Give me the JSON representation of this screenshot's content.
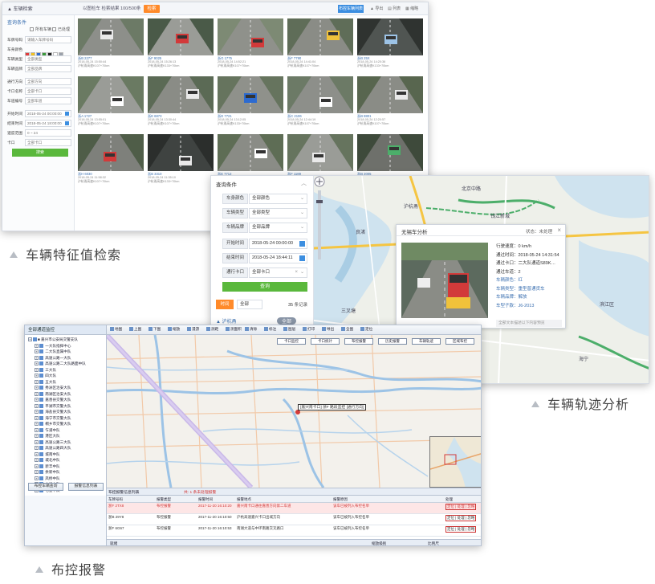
{
  "captions": {
    "search": "车辆特征值检索",
    "trajectory": "车辆轨迹分析",
    "alarm": "布控报警"
  },
  "search": {
    "app_title": "▲ 车辆检索",
    "crumb": "以图检车 检索结果 100/500条",
    "top_action": "检索",
    "top_btn": "布控车辆列表",
    "top_links": [
      "▲ 导出",
      "▤ 列表",
      "▦ 缩略"
    ],
    "side_title": "查询条件",
    "checks": [
      "所有车辆",
      "已处理"
    ],
    "filters": [
      {
        "label": "车牌号码",
        "value": "请输入车牌号码"
      },
      {
        "label": "车身颜色",
        "value": ""
      },
      {
        "label": "车辆类型",
        "value": "全部类型"
      },
      {
        "label": "车辆品牌",
        "value": "全部品牌"
      },
      {
        "label": "通行方向",
        "value": "全部方向"
      },
      {
        "label": "卡口名称",
        "value": "全部卡口"
      },
      {
        "label": "车道编号",
        "value": "全部车道"
      },
      {
        "label": "开始时间",
        "value": "2018-05-24 00:00:00"
      },
      {
        "label": "结束时间",
        "value": "2018-05-24 18:00:00"
      },
      {
        "label": "速度范围",
        "value": "0 ~ 24"
      },
      {
        "label": "卡口",
        "value": "全部卡口"
      }
    ],
    "swatch_colors": [
      "#e23b3b",
      "#f4c21f",
      "#2d6bd0",
      "#3a9a3a",
      "#222222",
      "#ffffff",
      "#9aa1aa"
    ],
    "search_btn": "搜索",
    "cards": [
      {
        "plate": "浙B 2277",
        "time": "2018-05-24 15:50:44",
        "place": "沪杭甬高速K107+70km"
      },
      {
        "plate": "浙F 9025",
        "time": "2018-05-24 15:26:13",
        "place": "沪杭甬高速K133+70km"
      },
      {
        "plate": "浙G 1775",
        "time": "2018-05-24 14:52:21",
        "place": "沪杭甬高速K107+70km"
      },
      {
        "plate": "浙F 7790",
        "time": "2018-05-24 14:41:04",
        "place": "沪杭甬高速K107+70km"
      },
      {
        "plate": "浙B 25X",
        "time": "2018-05-24 14:20:36",
        "place": "沪杭甬高速K133+70km"
      },
      {
        "plate": "浙A 1727",
        "time": "2018-05-24 13:55:01",
        "place": "沪杭甬高速K107+70km"
      },
      {
        "plate": "浙E 6873",
        "time": "2018-05-24 13:30:44",
        "place": "沪杭甬高速K107+70km"
      },
      {
        "plate": "浙D 7721",
        "time": "2018-05-24 13:12:05",
        "place": "沪杭甬高速K133+70km"
      },
      {
        "plate": "浙C 2106",
        "time": "2018-05-24 12:44:19",
        "place": "沪杭甬高速K107+70km"
      },
      {
        "plate": "浙B 8801",
        "time": "2018-05-24 12:20:57",
        "place": "沪杭甬高速K107+70km"
      },
      {
        "plate": "浙H 6030",
        "time": "2018-05-24 11:58:32",
        "place": "沪杭甬高速K107+70km"
      },
      {
        "plate": "浙B 3310",
        "time": "2018-05-24 11:35:10",
        "place": "沪杭甬高速K133+70km"
      },
      {
        "plate": "浙E 7712",
        "time": "2018-05-24 11:02:48",
        "place": "沪杭甬高速K107+70km"
      },
      {
        "plate": "浙F 1189",
        "time": "2018-05-24 10:41:27",
        "place": "沪杭甬高速K107+70km"
      },
      {
        "plate": "浙B 2005",
        "time": "2018-05-24 10:18:03",
        "place": "沪杭甬高速K133+70km"
      }
    ]
  },
  "trajectory": {
    "panel_title": "查询条件",
    "rows": [
      {
        "label": "车身颜色",
        "value": "全部颜色"
      },
      {
        "label": "车辆类型",
        "value": "全部类型"
      },
      {
        "label": "车辆品牌",
        "value": "全部品牌"
      },
      {
        "label": "开始时间",
        "value": "2018-05-24 00:00:00"
      },
      {
        "label": "结束时间",
        "value": "2018-05-24 18:44:11"
      },
      {
        "label": "通行卡口",
        "value": "全部卡口"
      }
    ],
    "query_btn": "查询",
    "tl_badge": "时间",
    "tl_select": "全部",
    "tl_count": "35",
    "tl_count_unit": "条记录",
    "bottom_tag": "▲ 沪杭甬",
    "bottom_btn": "全部",
    "map_labels": [
      "沪杭甬",
      "北京中路",
      "钱江新城",
      "三叉塘",
      "滨江区",
      "良渚",
      "海宁"
    ],
    "popup": {
      "title": "无锡车分析",
      "status": "状态：未处理",
      "speed": "行驶速度：0 km/h",
      "pass_time": "通过时间：2018-05-24 14:31:54",
      "checkpoint": "通过卡口：二大队通道S89K…",
      "lane": "通过车道：2",
      "color": "车辆颜色：红",
      "type": "车辆类型：重型普通货车",
      "brand": "车辆品牌：解放",
      "model": "车型子款：J6-2013",
      "footer": "全部文本描述以下内容预览"
    }
  },
  "alarm": {
    "tree_title": "全部通道监控",
    "tree_nodes": [
      "■ 嘉兴市公安局交警支队",
      "  一大队指挥中心",
      "  二大队直属中队",
      "  高速公路一大队",
      "  高速公路二大队路面中队",
      "  三大队",
      "  四大队",
      "  五大队",
      "  秀洲区治安大队",
      "  南湖区治安大队",
      "  嘉善县交警大队",
      "  平湖市交警大队",
      "  海盐县交警大队",
      "  海宁市交警大队",
      "  桐乡市交警大队",
      "  乍浦中队",
      "  港区大队",
      "  高速公路三大队",
      "  高速公路四大队",
      "  城南中队",
      "  城北中队",
      "  新丰中队",
      "  余新中队",
      "  凤桥中队",
      "  大桥中队",
      "  七星中队"
    ],
    "tree_btns": [
      "布控车辆查询",
      "报警信息列表"
    ],
    "tools": [
      "地图",
      "上图",
      "下图",
      "缩放",
      "漫游",
      "测距",
      "测面积",
      "清除",
      "标注",
      "图层",
      "打印",
      "导出",
      "全图",
      "定位"
    ],
    "map_cards": [
      "卡口监控",
      "卡口统计",
      "布控报警",
      "历史报警",
      "车辆轨迹",
      "区域布控"
    ],
    "marker_label": "[嘉兴南卡口] 浙F 路段监控 [通行方向]",
    "bar_title": "布控报警信息列表",
    "bar_note": "共: 1 条未处理报警",
    "columns": [
      "车牌号码",
      "报警类型",
      "报警时间",
      "报警地点",
      "报警原因",
      "处理"
    ],
    "rows": [
      {
        "plate": "浙F 2TX8",
        "type": "布控报警",
        "time": "2017-11-20 16:10:20",
        "place": "嘉兴南卡口通往嘉善方向第二车道",
        "reason": "该车已被列入布控名单",
        "op": "定位 | 处理 | 忽略"
      },
      {
        "plate": "浙B 29Y8",
        "type": "布控报警",
        "time": "2017-11-20 16:10:50",
        "place": "沪杭高速嘉兴卡口出城方向",
        "reason": "该车已被列入布控名单",
        "op": "定位 | 处理 | 忽略"
      },
      {
        "plate": "浙F 6G67",
        "type": "布控报警",
        "time": "2017-11-20 16:10:53",
        "place": "南湖大道与中环南路交叉路口",
        "reason": "该车已被列入布控名单",
        "op": "定位 | 处理 | 忽略"
      }
    ],
    "status_items": [
      "就绪",
      "缩放级别",
      "比例尺"
    ]
  }
}
